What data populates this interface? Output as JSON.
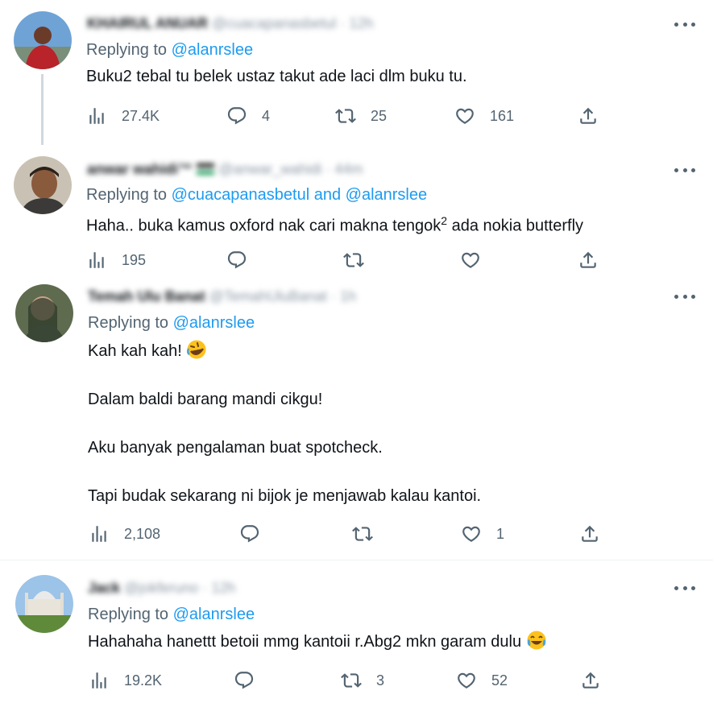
{
  "replying_prefix": "Replying to",
  "replies": [
    {
      "name": "KHAIRUL ANUAR",
      "handle": "@cuacapanasbetul",
      "time": "· 12h",
      "reply_to_1": "@alanrslee",
      "reply_joiner": "",
      "reply_to_2": "",
      "lines": [
        "Buku2 tebal tu belek ustaz takut ade laci dlm buku tu."
      ],
      "views": "27.4K",
      "replies_count": "4",
      "retweets": "25",
      "likes": "161"
    },
    {
      "name": "anwar wahidi™",
      "handle": "@anwar_wahidi",
      "time": "· 44m",
      "reply_to_1": "@cuacapanasbetul",
      "reply_joiner": " and ",
      "reply_to_2": "@alanrslee",
      "line_pre": "Haha.. buka kamus oxford nak cari makna tengok",
      "line_sup": "2",
      "line_post": " ada nokia butterfly",
      "views": "195",
      "replies_count": "",
      "retweets": "",
      "likes": ""
    },
    {
      "name": "Temah Ulu Banat",
      "handle": "@TemahUluBanat",
      "time": "· 1h",
      "reply_to_1": "@alanrslee",
      "reply_joiner": "",
      "reply_to_2": "",
      "line1": "Kah kah kah!",
      "line3": "Dalam baldi barang mandi cikgu!",
      "line5": "Aku banyak pengalaman buat spotcheck.",
      "line7": "Tapi budak sekarang ni bijok je menjawab kalau kantoi.",
      "views": "2,108",
      "replies_count": "",
      "retweets": "",
      "likes": "1"
    },
    {
      "name": "Jack",
      "handle": "@jokferuno",
      "time": "· 12h",
      "reply_to_1": "@alanrslee",
      "reply_joiner": "",
      "reply_to_2": "",
      "line": "Hahahaha hanettt betoii mmg kantoii r.Abg2 mkn garam dulu",
      "views": "19.2K",
      "replies_count": "",
      "retweets": "3",
      "likes": "52"
    }
  ],
  "icons": {
    "views": "bar-chart-icon",
    "reply": "speech-bubble-icon",
    "retweet": "retweet-icon",
    "like": "heart-icon",
    "share": "share-upload-icon",
    "more": "more-dots-icon"
  },
  "colors": {
    "accent": "#1d9bf0",
    "secondary_text": "#536471",
    "primary_text": "#0f1419",
    "divider": "#eff3f4"
  }
}
